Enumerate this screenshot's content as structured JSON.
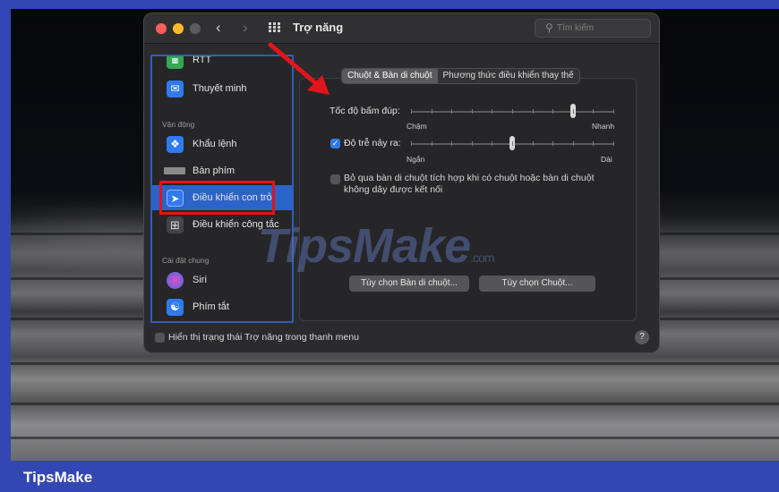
{
  "window": {
    "title": "Trợ năng"
  },
  "search": {
    "placeholder": "Tìm kiếm"
  },
  "sidebar": {
    "items": [
      {
        "label": "RTT",
        "icon": "rtt-icon",
        "color": "#34a853"
      },
      {
        "label": "Thuyết minh",
        "icon": "speech-bubble-icon",
        "color": "#2f7af0"
      },
      {
        "label": "Khẩu lệnh",
        "icon": "voice-control-icon",
        "color": "#2f7af0"
      },
      {
        "label": "Bàn phím",
        "icon": "keyboard-icon",
        "color": "#8a8a8a"
      },
      {
        "label": "Điều khiển con trỏ",
        "icon": "pointer-icon",
        "color": "#2f7af0",
        "selected": true
      },
      {
        "label": "Điều khiển công tắc",
        "icon": "switch-grid-icon",
        "color": "#444446"
      },
      {
        "label": "Siri",
        "icon": "siri-icon",
        "color": "#7a4cc8"
      },
      {
        "label": "Phím tắt",
        "icon": "accessibility-shortcut-icon",
        "color": "#2f7af0"
      }
    ],
    "sections": {
      "motor": "Vận động",
      "general": "Cài đặt chung"
    }
  },
  "tabs": {
    "active": "Chuột & Bàn di chuột",
    "alternate": "Phương thức điều khiển thay thế"
  },
  "settings": {
    "double_click_label": "Tốc độ bấm đúp:",
    "double_click_min": "Chậm",
    "double_click_max": "Nhanh",
    "double_click_value": 0.8,
    "spring_delay_label": "Độ trễ nảy ra:",
    "spring_delay_checked": true,
    "spring_delay_min": "Ngắn",
    "spring_delay_max": "Dài",
    "spring_delay_value": 0.5,
    "ignore_trackpad_checked": false,
    "ignore_trackpad_line1": "Bỏ qua bàn di chuột tích hợp khi có chuột hoặc bàn di chuột",
    "ignore_trackpad_line2": "không dây được kết nối"
  },
  "buttons": {
    "trackpad_options": "Tùy chọn Bàn di chuột...",
    "mouse_options": "Tùy chọn Chuột..."
  },
  "footer": {
    "menu_status": "Hiển thị trạng thái Trợ năng trong thanh menu",
    "help": "?"
  },
  "watermark": {
    "text": "TipsMake",
    "suffix": ".com"
  },
  "brand": {
    "text": "TipsMake"
  },
  "colors": {
    "accent": "#2f7af0",
    "highlight_box": "#e2151c",
    "frame_blue": "#3346b3"
  }
}
